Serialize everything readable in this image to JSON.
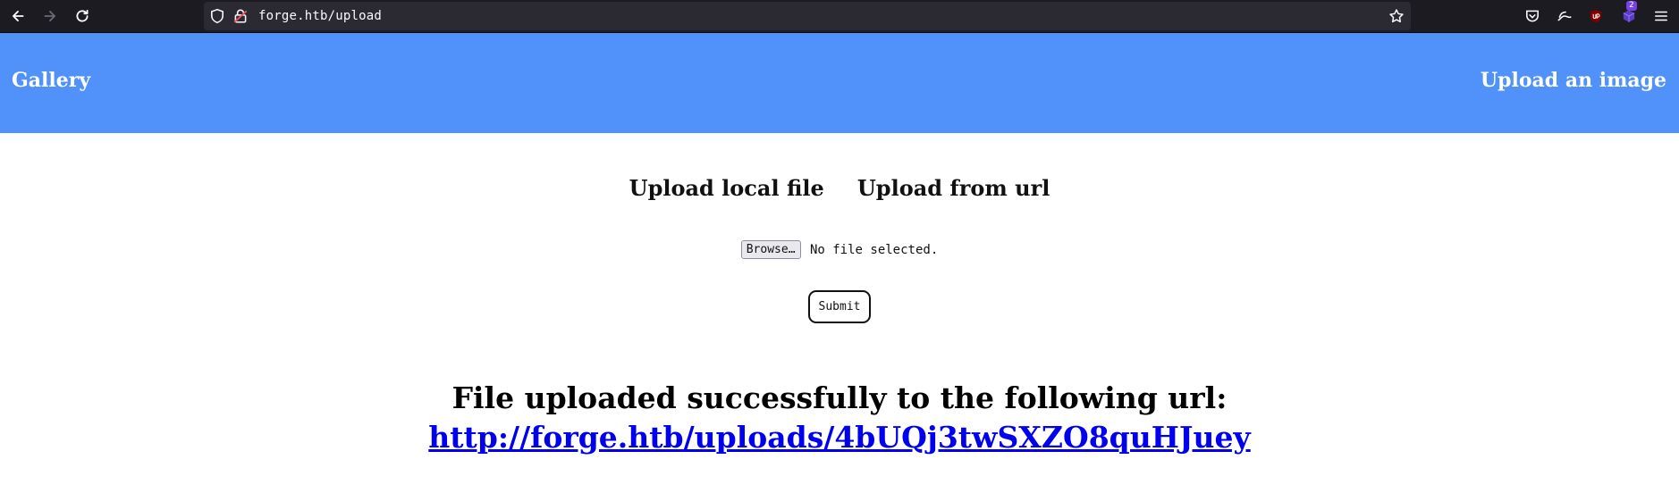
{
  "browser": {
    "url": "forge.htb/upload",
    "extension_badge": "2"
  },
  "header": {
    "left_link": "Gallery",
    "right_link": "Upload an image",
    "color": "#5191fa"
  },
  "tabs": [
    {
      "label": "Upload local file"
    },
    {
      "label": "Upload from url"
    }
  ],
  "form": {
    "browse_label": "Browse…",
    "file_status": "No file selected.",
    "submit_label": "Submit"
  },
  "result": {
    "message": "File uploaded successfully to the following url:",
    "link": "http://forge.htb/uploads/4bUQj3twSXZO8quHJuey",
    "link_color": "#0000ee"
  }
}
